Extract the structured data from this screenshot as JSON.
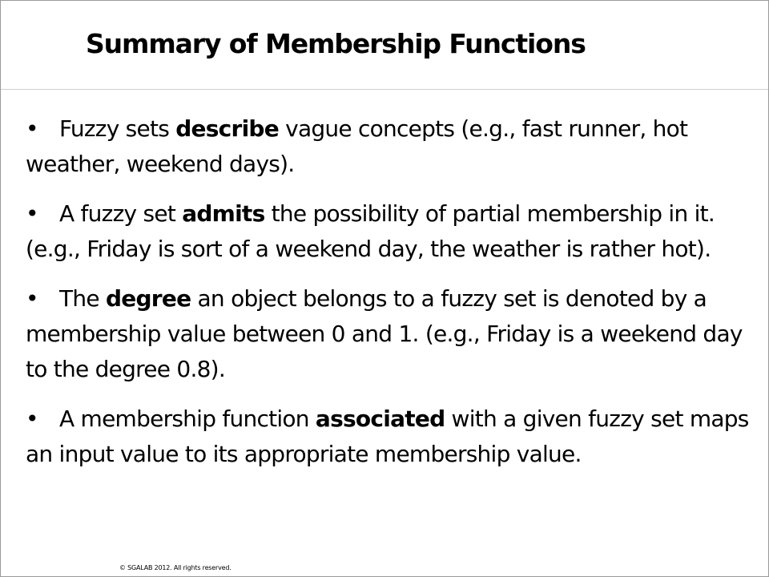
{
  "title": "Summary of Membership Functions",
  "bullets": [
    {
      "marker": "•",
      "before": "Fuzzy sets ",
      "bold": "describe",
      "after": " vague concepts (e.g., fast runner, hot weather, weekend days)."
    },
    {
      "marker": "•",
      "before": "A fuzzy set ",
      "bold": "admits",
      "after": " the possibility of partial membership in it. (e.g., Friday is sort of a weekend day, the weather is rather hot)."
    },
    {
      "marker": "•",
      "before": "The ",
      "bold": "degree",
      "after": " an object belongs to a fuzzy set is denoted by a membership value between 0 and 1. (e.g., Friday is a weekend day to the degree 0.8)."
    },
    {
      "marker": "•",
      "before": "A membership function ",
      "bold": "associated",
      "after": " with a given fuzzy set maps an input value to its appropriate membership value."
    }
  ],
  "footer": "© SGALAB 2012. All rights reserved."
}
